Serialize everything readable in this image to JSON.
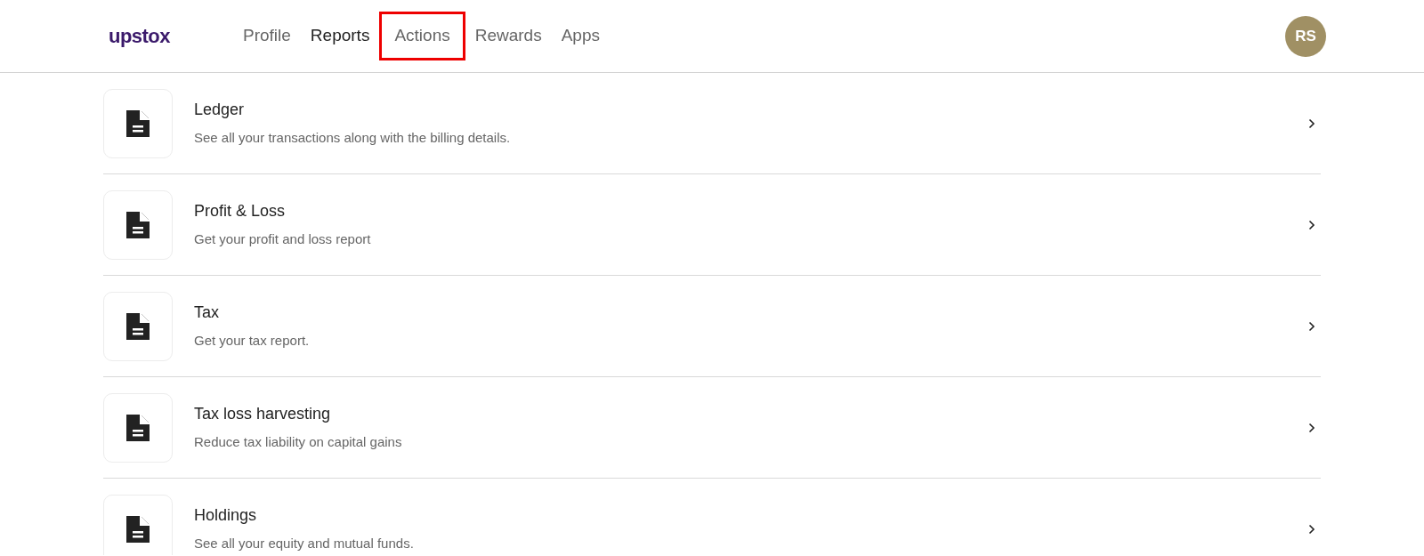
{
  "header": {
    "logo": "upstox",
    "nav": [
      {
        "label": "Profile",
        "selected": false,
        "highlighted": false
      },
      {
        "label": "Reports",
        "selected": true,
        "highlighted": false
      },
      {
        "label": "Actions",
        "selected": false,
        "highlighted": true
      },
      {
        "label": "Rewards",
        "selected": false,
        "highlighted": false
      },
      {
        "label": "Apps",
        "selected": false,
        "highlighted": false
      }
    ],
    "avatar": "RS"
  },
  "reports": [
    {
      "title": "Ledger",
      "description": "See all your transactions along with the billing details."
    },
    {
      "title": "Profit & Loss",
      "description": "Get your profit and loss report"
    },
    {
      "title": "Tax",
      "description": "Get your tax report."
    },
    {
      "title": "Tax loss harvesting",
      "description": "Reduce tax liability on capital gains"
    },
    {
      "title": "Holdings",
      "description": "See all your equity and mutual funds."
    }
  ]
}
